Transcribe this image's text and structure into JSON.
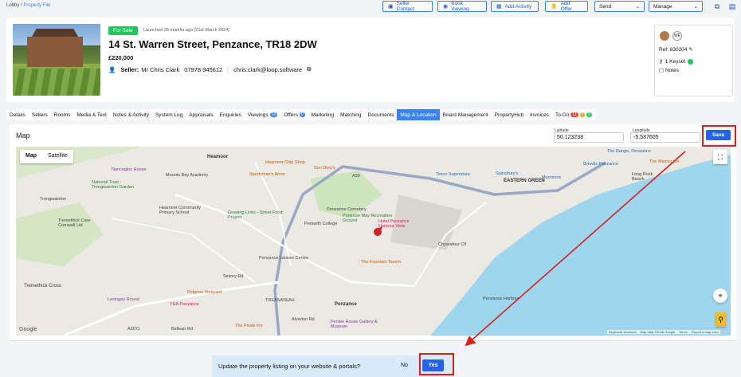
{
  "breadcrumb": {
    "root": "Lobby",
    "sep": "/",
    "current": "Property File"
  },
  "toolbar": {
    "seller_contact": "Seller Contact",
    "book_viewing": "Book Viewing",
    "add_activity": "Add Activity",
    "add_offer": "Add Offer",
    "send": "Send:",
    "manage": "Manage"
  },
  "property": {
    "status": "For Sale",
    "launched": "Launched 28 months ago (21st March 2024)",
    "address": "14 St. Warren Street, Penzance, TR18 2DW",
    "price": "£220,000",
    "seller_label": "Seller:",
    "seller_name": "Mr Chris Clark",
    "phone": "07978 945612",
    "email": "chris.clark@loop.software",
    "agent_initials": "WE",
    "ref": "Ref: 830204",
    "keyset": "1 Keyset",
    "notes": "Notes"
  },
  "tabs": [
    "Details",
    "Sellers",
    "Rooms",
    "Media & Text",
    "Notes & Activity",
    "System Log",
    "Appraisals",
    "Enquiries",
    "Viewings",
    "Offers",
    "Marketing",
    "Matching",
    "Documents",
    "Map & Location",
    "Board Management",
    "PropertyHub",
    "Invoices",
    "To-Do"
  ],
  "tab_badges": {
    "viewings": "10",
    "offers": "0",
    "todo": [
      "11",
      "0",
      "0"
    ]
  },
  "map_section": {
    "title": "Map",
    "latitude_label": "Latitude",
    "latitude": "50.123238",
    "longitude_label": "Longitude",
    "longitude": "-5.537605",
    "save": "Save",
    "toggle_map": "Map",
    "toggle_satellite": "Satellite",
    "google": "Google",
    "attribution": [
      "Keyboard shortcuts",
      "Map data ©2026 Google",
      "Terms",
      "Report a map error"
    ]
  },
  "map_labels": {
    "places": [
      "Heamoor",
      "EASTERN GREEN",
      "Penzance",
      "Tremethick Cross",
      "Trengwainton"
    ],
    "pois": [
      "Nanceglos House",
      "Mounts Bay Academy",
      "National Trust - Trengwainton Garden",
      "Heamoor Chip Shop",
      "Sportsman's Arms",
      "Sun Dory's",
      "Tesco Superstore",
      "Sainsbury's",
      "Morrisons",
      "The Range, Penzance",
      "Brewfis Penzance",
      "The Mexico Inn",
      "Long Rock Beach",
      "Heamoor Community Primary School",
      "Growing Links - Street Food Project",
      "Penzance Cemetery",
      "Primrose May Recreation Ground",
      "Hotel Penzance Harbour View",
      "Pemwith College",
      "Penzance Leisure Centre",
      "The Fountain Tavern",
      "Penzance Harbour",
      "Polgoon Vineyard",
      "Lesingey Round",
      "YHA Penzance",
      "The Pirate Inn",
      "Penlee House Gallery & Museum",
      "Bellean Rd",
      "Alverton Rd",
      "TREASAVEAH",
      "Seleny Rd",
      "Tremethick Care Cornwall Ltd"
    ],
    "roads": [
      "A30",
      "A3071",
      "Chyandour Clf"
    ]
  },
  "dialog": {
    "question": "Update the property listing on your website & portals?",
    "no": "No",
    "yes": "Yes"
  },
  "colors": {
    "accent": "#2563eb",
    "annotation": "#d32121",
    "status": "#22c55e",
    "sea": "#9fd6ee"
  }
}
